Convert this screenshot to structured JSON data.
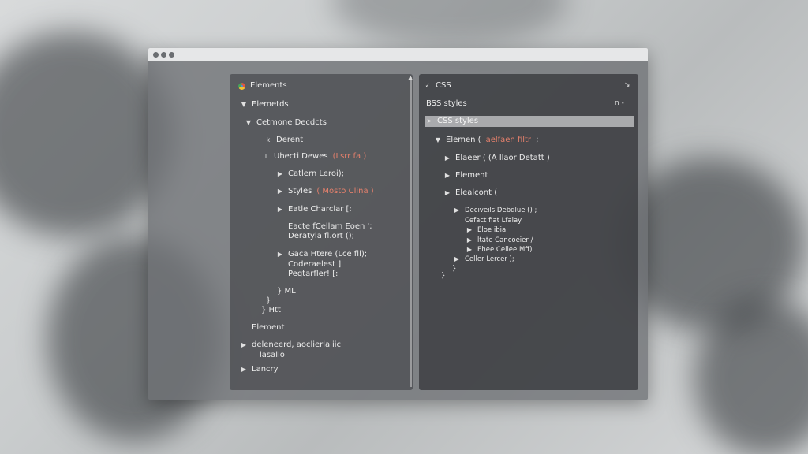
{
  "left_panel": {
    "header": "Elements",
    "rows": [
      {
        "caret": "▼",
        "text": "Elemetds"
      },
      {
        "caret": "▼",
        "text": "Cetmone Decdcts"
      },
      {
        "caret": "k",
        "text": "Derent"
      },
      {
        "caret": "l",
        "text": "Uhecti Dewes",
        "accent": "(Lsrr fa )"
      },
      {
        "caret": "▶",
        "text": "Catlern Leroi);"
      },
      {
        "caret": "▶",
        "text": "Styles",
        "accent": "( Mosto Clina )"
      },
      {
        "caret": "▶",
        "text": "Eatle Charclar [:"
      },
      {
        "caret": "",
        "text": "Eacte fCellam Eoen ';"
      },
      {
        "caret": "",
        "text": "Deratyla fl.ort ();"
      },
      {
        "caret": "▶",
        "text": "Gaca Htere (Lce fll);"
      },
      {
        "caret": "",
        "text": "Coderaelest ]"
      },
      {
        "caret": "",
        "text": "Pegtarfler! [:"
      },
      {
        "caret": "",
        "text": "} ML"
      },
      {
        "caret": "",
        "text": "}"
      },
      {
        "caret": "",
        "text": "} Htt"
      },
      {
        "caret": "",
        "text": "Element"
      },
      {
        "caret": "▶",
        "text": "deleneerd, aoclierlaliic"
      },
      {
        "caret": "",
        "text": "lasallo"
      },
      {
        "caret": "▶",
        "text": "Lancry"
      }
    ]
  },
  "right_panel": {
    "header": "CSS",
    "subheader": "BSS styles",
    "selected": "CSS styles",
    "rows": [
      {
        "caret": "▼",
        "text": "Elemen (",
        "accent": "aelfaen filtr",
        "tail": ";"
      },
      {
        "caret": "▶",
        "text": "Elaeer ( (A llaor Detatt )"
      },
      {
        "caret": "▶",
        "text": "Element"
      },
      {
        "caret": "▶",
        "text": "Elealcont ("
      },
      {
        "caret": "▶",
        "text": "Deciveils Debdlue () ;"
      },
      {
        "caret": "",
        "text": "Cefact fiat Lfalay"
      },
      {
        "caret": "▶",
        "text": "Eloe ibia"
      },
      {
        "caret": "▶",
        "text": "ltate Cancoeier /"
      },
      {
        "caret": "▶",
        "text": "Ehee Cellee Mff)"
      },
      {
        "caret": "▶",
        "text": "Celler Lercer );"
      },
      {
        "caret": "",
        "text": "}"
      },
      {
        "caret": "",
        "text": "}"
      }
    ],
    "header_controls": {
      "top_right": "↘",
      "sub_right": "n -"
    }
  },
  "icons": {
    "window_dots": [
      "window-dot-icon",
      "window-dot-icon",
      "window-dot-icon"
    ],
    "left_header": "chrome-icon",
    "right_header": "check-icon",
    "cursor": "mouse-pointer-icon"
  },
  "colors": {
    "accent": "#e5806c",
    "panel": "#484a4d",
    "selected": "#bec0c2"
  }
}
